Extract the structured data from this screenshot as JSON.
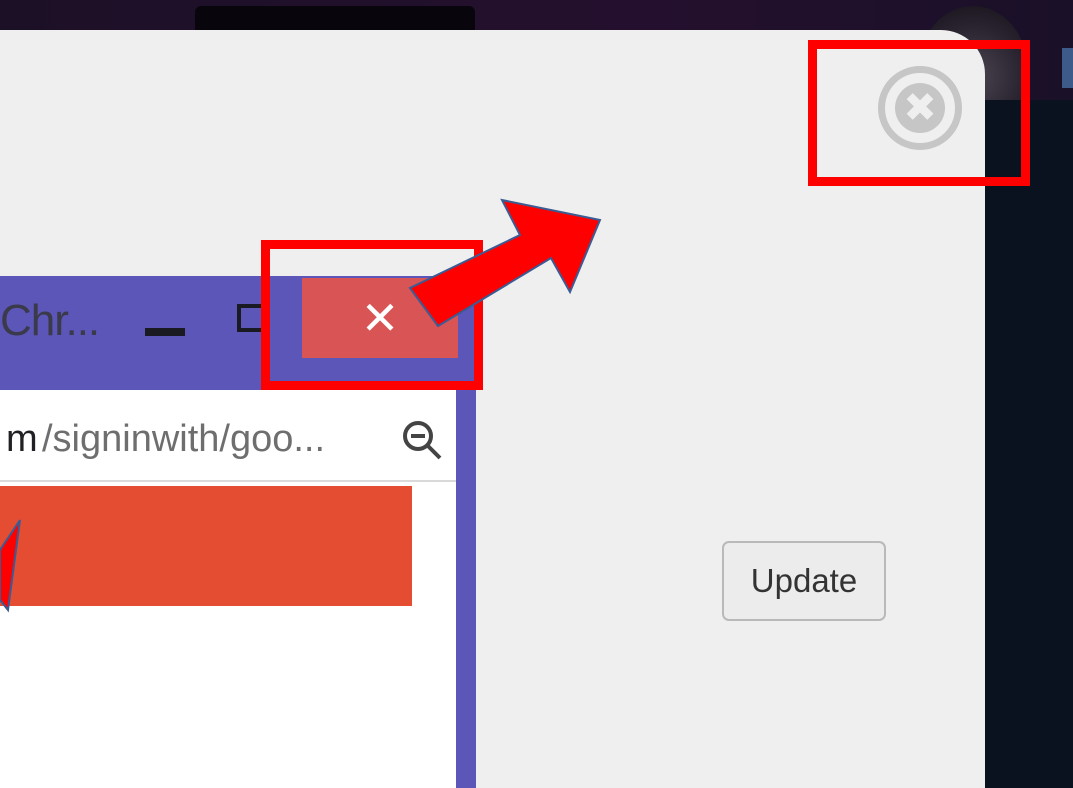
{
  "chrome_window": {
    "title_truncated": "Chr...",
    "close_glyph": "✕",
    "address": {
      "host_fragment": "m",
      "path": "/signinwith/goo..."
    }
  },
  "popup": {
    "update_button_label": "Update",
    "close_glyph": "✖"
  },
  "annotations": {
    "highlight_color": "#ff0000",
    "arrow_color": "#ff0000"
  },
  "colors": {
    "window_frame": "#5c56b8",
    "close_hover": "#d95454",
    "orange_banner": "#e54d33",
    "popup_bg": "#efefef"
  },
  "icons": [
    "minimize-icon",
    "maximize-icon",
    "close-icon",
    "zoom-out-icon",
    "circle-close-icon"
  ]
}
